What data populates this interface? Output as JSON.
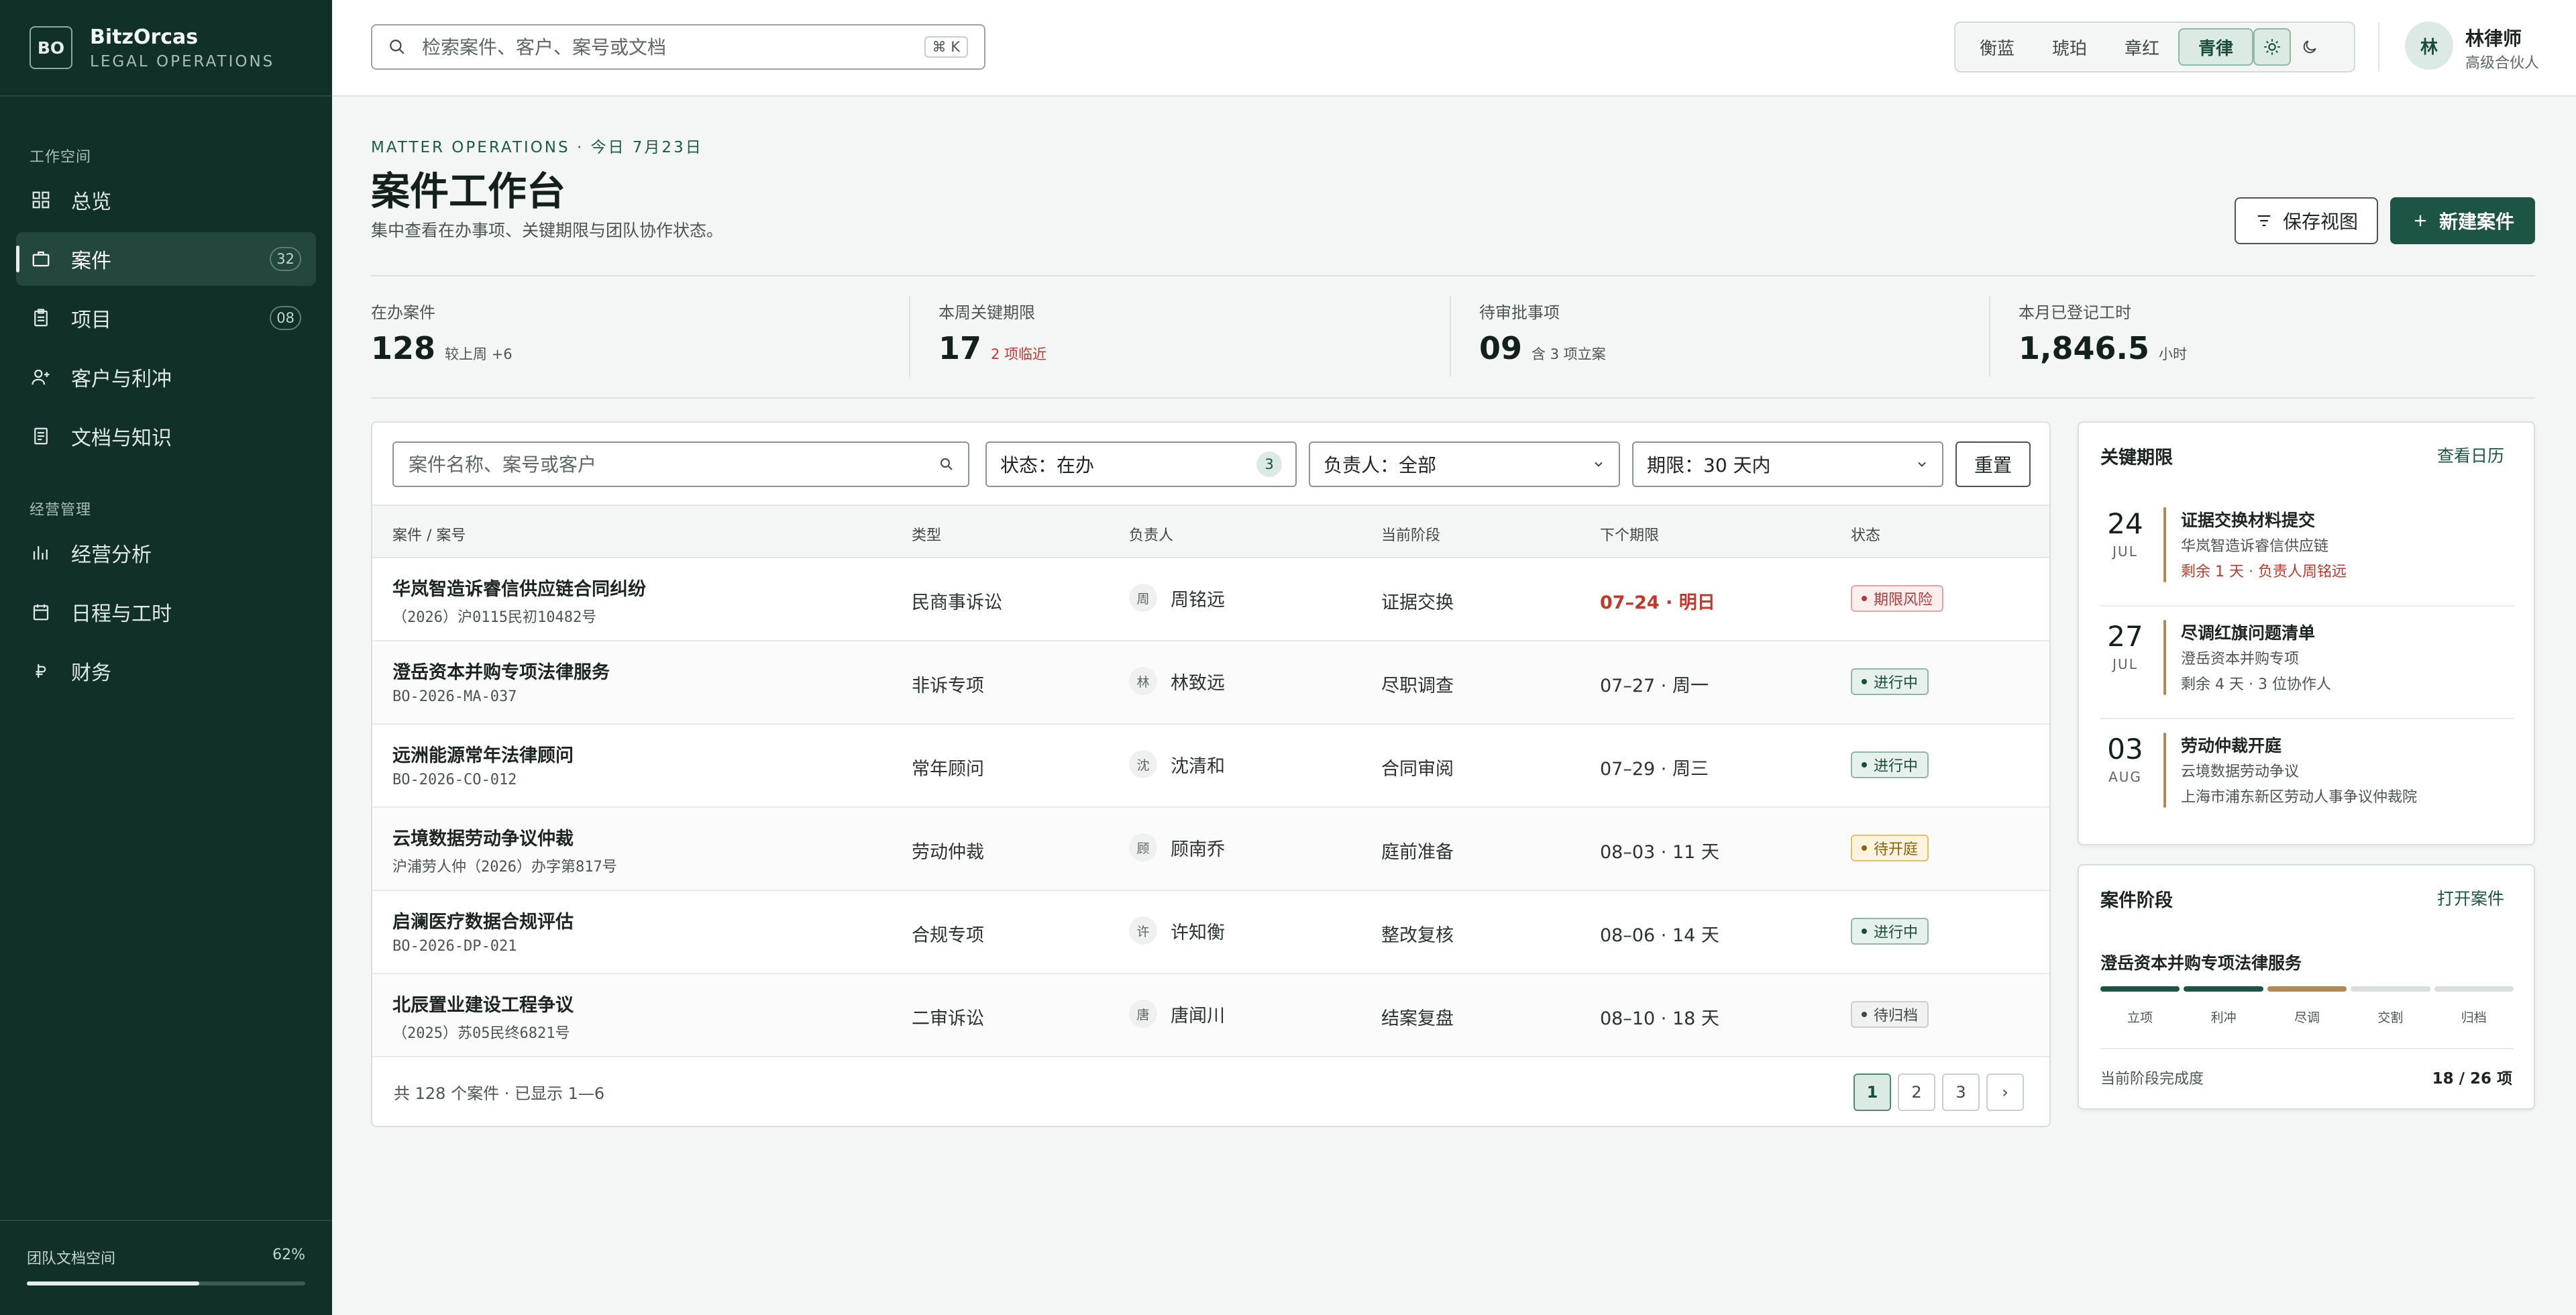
{
  "brand": {
    "logo": "BO",
    "name": "BitzOrcas",
    "sub": "LEGAL OPERATIONS"
  },
  "sidebar": {
    "section1": "工作空间",
    "section2": "经营管理",
    "items": [
      {
        "label": "总览",
        "icon": "grid-icon",
        "badge": ""
      },
      {
        "label": "案件",
        "icon": "briefcase-icon",
        "badge": "32"
      },
      {
        "label": "项目",
        "icon": "clipboard-icon",
        "badge": "08"
      },
      {
        "label": "客户与利冲",
        "icon": "user-plus-icon",
        "badge": ""
      },
      {
        "label": "文档与知识",
        "icon": "document-icon",
        "badge": ""
      },
      {
        "label": "经营分析",
        "icon": "bar-chart-icon",
        "badge": ""
      },
      {
        "label": "日程与工时",
        "icon": "calendar-icon",
        "badge": ""
      },
      {
        "label": "财务",
        "icon": "currency-icon",
        "badge": ""
      }
    ],
    "storage": {
      "label": "团队文档空间",
      "percent_text": "62%",
      "percent": 62
    }
  },
  "topbar": {
    "search_placeholder": "检索案件、客户、案号或文档",
    "shortcut": "⌘ K",
    "themes": [
      "衡蓝",
      "琥珀",
      "章红",
      "青律"
    ],
    "active_theme": "青律",
    "user": {
      "initial": "林",
      "name": "林律师",
      "role": "高级合伙人"
    }
  },
  "header": {
    "eyebrow": "MATTER OPERATIONS · 今日 7月23日",
    "title": "案件工作台",
    "subtitle": "集中查看在办事项、关键期限与团队协作状态。",
    "save_view": "保存视图",
    "new_case": "新建案件"
  },
  "kpis": [
    {
      "label": "在办案件",
      "value": "128",
      "note": "较上周 +6",
      "warn": false
    },
    {
      "label": "本周关键期限",
      "value": "17",
      "note": "2 项临近",
      "warn": true
    },
    {
      "label": "待审批事项",
      "value": "09",
      "note": "含 3 项立案",
      "warn": false
    },
    {
      "label": "本月已登记工时",
      "value": "1,846.5",
      "note": "小时",
      "warn": false
    }
  ],
  "filters": {
    "search_placeholder": "案件名称、案号或客户",
    "status": "状态：在办",
    "status_count": "3",
    "owner": "负责人：全部",
    "period": "期限：30 天内",
    "reset": "重置"
  },
  "table": {
    "headers": [
      "案件 / 案号",
      "类型",
      "负责人",
      "当前阶段",
      "下个期限",
      "状态"
    ],
    "rows": [
      {
        "name": "华岚智造诉睿信供应链合同纠纷",
        "no": "（2026）沪0115民初10482号",
        "type": "民商事诉讼",
        "owner_initial": "周",
        "owner": "周铭远",
        "stage": "证据交换",
        "due": "07–24 · 明日",
        "urgent": true,
        "status": "期限风险",
        "status_kind": "risk"
      },
      {
        "name": "澄岳资本并购专项法律服务",
        "no": "BO-2026-MA-037",
        "type": "非诉专项",
        "owner_initial": "林",
        "owner": "林致远",
        "stage": "尽职调查",
        "due": "07–27 · 周一",
        "urgent": false,
        "status": "进行中",
        "status_kind": "ok"
      },
      {
        "name": "远洲能源常年法律顾问",
        "no": "BO-2026-CO-012",
        "type": "常年顾问",
        "owner_initial": "沈",
        "owner": "沈清和",
        "stage": "合同审阅",
        "due": "07–29 · 周三",
        "urgent": false,
        "status": "进行中",
        "status_kind": "ok"
      },
      {
        "name": "云境数据劳动争议仲裁",
        "no": "沪浦劳人仲（2026）办字第817号",
        "type": "劳动仲裁",
        "owner_initial": "顾",
        "owner": "顾南乔",
        "stage": "庭前准备",
        "due": "08–03 · 11 天",
        "urgent": false,
        "status": "待开庭",
        "status_kind": "wait"
      },
      {
        "name": "启澜医疗数据合规评估",
        "no": "BO-2026-DP-021",
        "type": "合规专项",
        "owner_initial": "许",
        "owner": "许知衡",
        "stage": "整改复核",
        "due": "08–06 · 14 天",
        "urgent": false,
        "status": "进行中",
        "status_kind": "ok"
      },
      {
        "name": "北辰置业建设工程争议",
        "no": "（2025）苏05民终6821号",
        "type": "二审诉讼",
        "owner_initial": "唐",
        "owner": "唐闻川",
        "stage": "结案复盘",
        "due": "08–10 · 18 天",
        "urgent": false,
        "status": "待归档",
        "status_kind": "arch"
      }
    ],
    "footer": "共 128 个案件 · 已显示 1—6",
    "pages": [
      "1",
      "2",
      "3",
      "›"
    ]
  },
  "deadlines": {
    "title": "关键期限",
    "link": "查看日历",
    "items": [
      {
        "day": "24",
        "month": "JUL",
        "title": "证据交换材料提交",
        "client": "华岚智造诉睿信供应链",
        "note": "剩余 1 天 · 负责人周铭远",
        "warn": true
      },
      {
        "day": "27",
        "month": "JUL",
        "title": "尽调红旗问题清单",
        "client": "澄岳资本并购专项",
        "note": "剩余 4 天 · 3 位协作人",
        "warn": false
      },
      {
        "day": "03",
        "month": "AUG",
        "title": "劳动仲裁开庭",
        "client": "云境数据劳动争议",
        "note": "上海市浦东新区劳动人事争议仲裁院",
        "warn": false
      }
    ]
  },
  "stage": {
    "title": "案件阶段",
    "link": "打开案件",
    "case": "澄岳资本并购专项法律服务",
    "steps": [
      "立项",
      "利冲",
      "尽调",
      "交割",
      "归档"
    ],
    "completed_steps": 2,
    "current_step": 3,
    "progress_label": "当前阶段完成度",
    "progress_value": "18 / 26 项"
  },
  "colors": {
    "sidebar": "#12302a",
    "accent": "#1c5546",
    "current": "#b08a56",
    "risk": "#c0392b"
  }
}
